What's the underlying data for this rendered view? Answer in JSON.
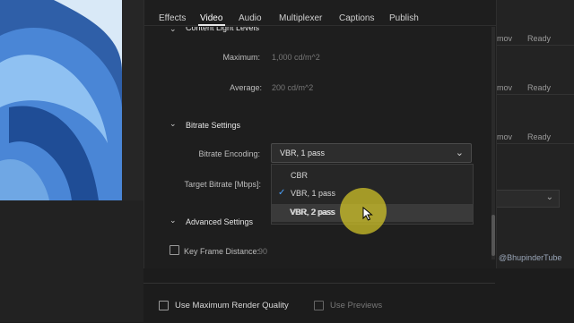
{
  "tabs": [
    "Effects",
    "Video",
    "Audio",
    "Multiplexer",
    "Captions",
    "Publish"
  ],
  "active_tab": "Video",
  "content_light": {
    "title": "Content Light Levels",
    "maximum_label": "Maximum:",
    "maximum_value": "1,000  cd/m^2",
    "average_label": "Average:",
    "average_value": "200  cd/m^2"
  },
  "bitrate": {
    "section_title": "Bitrate Settings",
    "encoding_label": "Bitrate Encoding:",
    "encoding_value": "VBR, 1 pass",
    "target_label": "Target Bitrate [Mbps]:",
    "options": [
      "CBR",
      "VBR, 1 pass",
      "VBR, 2 pass"
    ],
    "selected_option": "VBR, 1 pass",
    "hovered_option": "VBR, 2 pass"
  },
  "advanced": {
    "section_title": "Advanced Settings",
    "keyframe_label": "Key Frame Distance:",
    "keyframe_value": "90"
  },
  "footer": {
    "max_render_label": "Use Maximum Render Quality",
    "use_previews_label": "Use Previews"
  },
  "queue": {
    "rows": [
      {
        "format": "mov",
        "status": "Ready"
      },
      {
        "format": "mov",
        "status": "Ready"
      },
      {
        "format": "mov",
        "status": "Ready"
      }
    ]
  },
  "watermark": "@BhupinderTube",
  "colors": {
    "accent": "#4aa3ff",
    "highlight": "#d6c828"
  },
  "icons": [
    "caret-down-icon",
    "chevron-down-icon",
    "checkmark-icon",
    "mouse-cursor-icon"
  ]
}
